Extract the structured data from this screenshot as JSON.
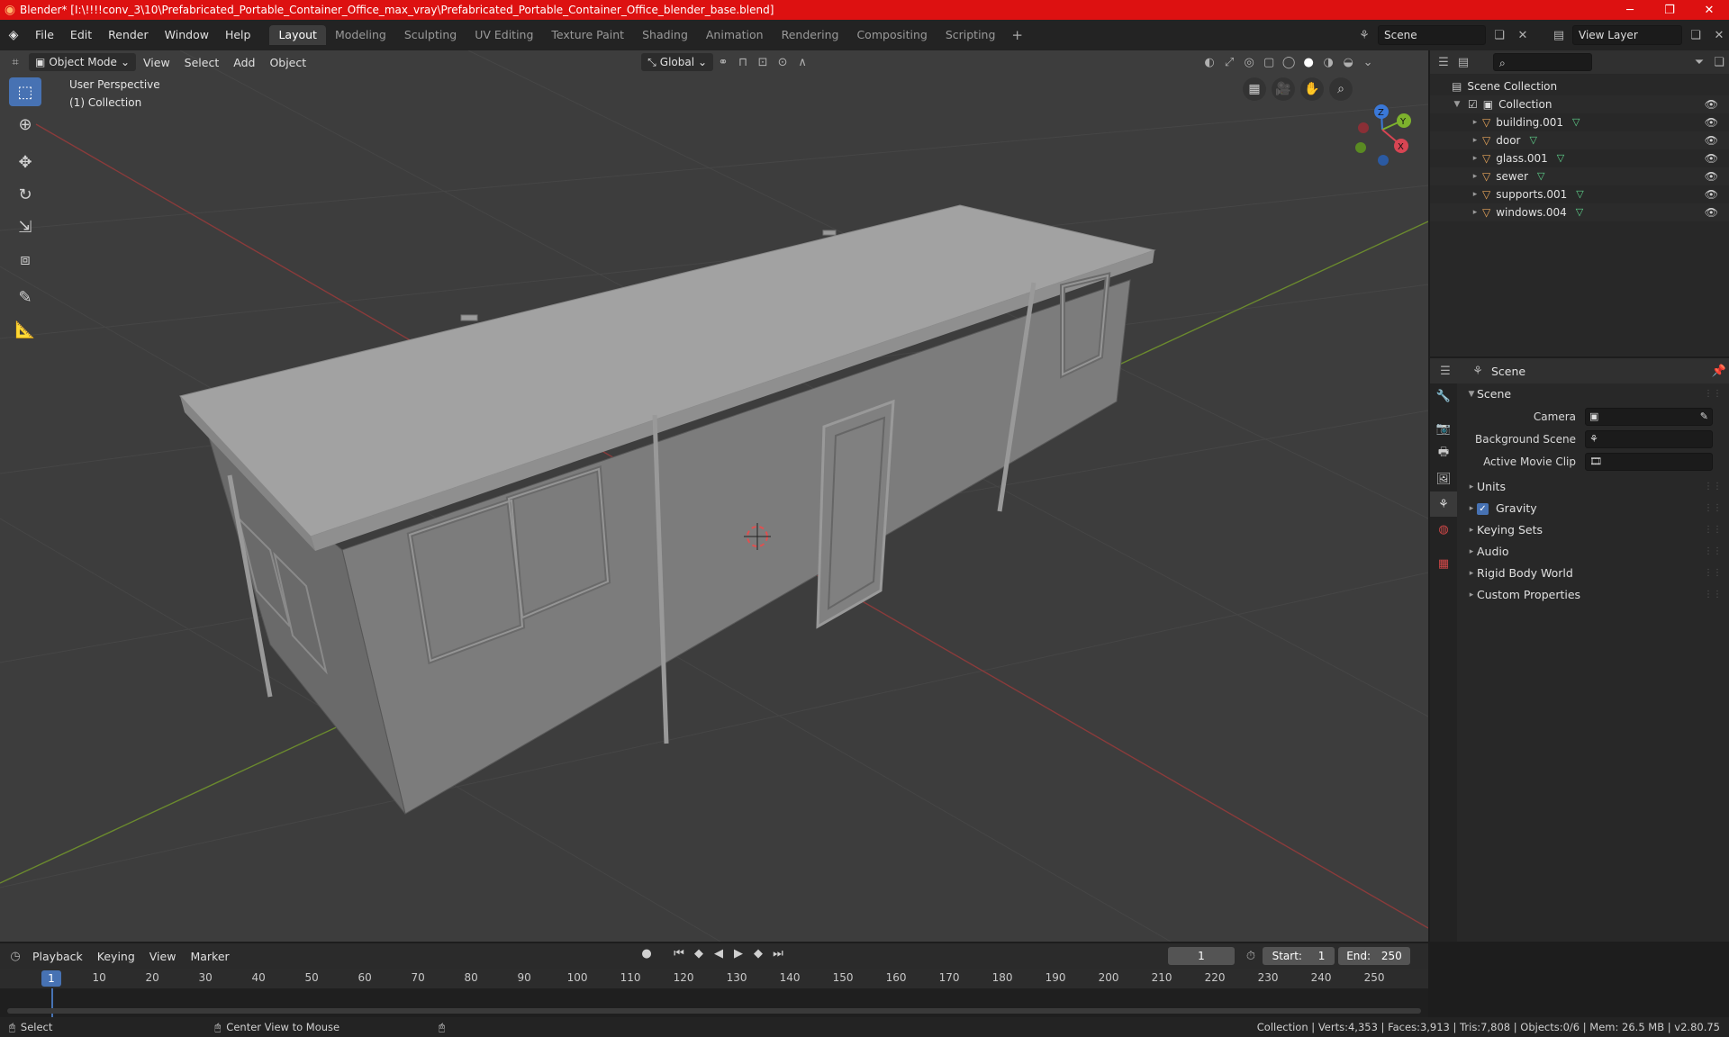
{
  "window": {
    "title": "Blender* [I:\\!!!!conv_3\\10\\Prefabricated_Portable_Container_Office_max_vray\\Prefabricated_Portable_Container_Office_blender_base.blend]",
    "minimize": "─",
    "maximize": "❐",
    "close": "✕"
  },
  "menu": [
    "File",
    "Edit",
    "Render",
    "Window",
    "Help"
  ],
  "workspaces": [
    "Layout",
    "Modeling",
    "Sculpting",
    "UV Editing",
    "Texture Paint",
    "Shading",
    "Animation",
    "Rendering",
    "Compositing",
    "Scripting"
  ],
  "workspace_active": "Layout",
  "top_right": {
    "scene": "Scene",
    "view_layer": "View Layer"
  },
  "viewport": {
    "mode": "Object Mode",
    "menus": [
      "View",
      "Select",
      "Add",
      "Object"
    ],
    "orientation": "Global",
    "info_line1": "User Perspective",
    "info_line2": "(1) Collection",
    "axes": {
      "z": "Z",
      "y": "Y",
      "x": "X"
    }
  },
  "outliner": {
    "root": "Scene Collection",
    "collection": "Collection",
    "items": [
      "building.001",
      "door",
      "glass.001",
      "sewer",
      "supports.001",
      "windows.004"
    ]
  },
  "properties": {
    "header": "Scene",
    "panel_title": "Scene",
    "camera_label": "Camera",
    "background_label": "Background Scene",
    "clip_label": "Active Movie Clip",
    "subpanels": [
      "Units",
      "Gravity",
      "Keying Sets",
      "Audio",
      "Rigid Body World",
      "Custom Properties"
    ],
    "gravity_checked": true
  },
  "timeline": {
    "menus": [
      "Playback",
      "Keying",
      "View",
      "Marker"
    ],
    "current_frame": "1",
    "start_label": "Start:",
    "start": "1",
    "end_label": "End:",
    "end": "250",
    "ticks": [
      "10",
      "20",
      "30",
      "40",
      "50",
      "60",
      "70",
      "80",
      "90",
      "100",
      "110",
      "120",
      "130",
      "140",
      "150",
      "160",
      "170",
      "180",
      "190",
      "200",
      "210",
      "220",
      "230",
      "240",
      "250"
    ]
  },
  "status": {
    "select": "Select",
    "center": "Center View to Mouse",
    "stats": "Collection | Verts:4,353 | Faces:3,913 | Tris:7,808 | Objects:0/6 | Mem: 26.5 MB | v2.80.75"
  }
}
